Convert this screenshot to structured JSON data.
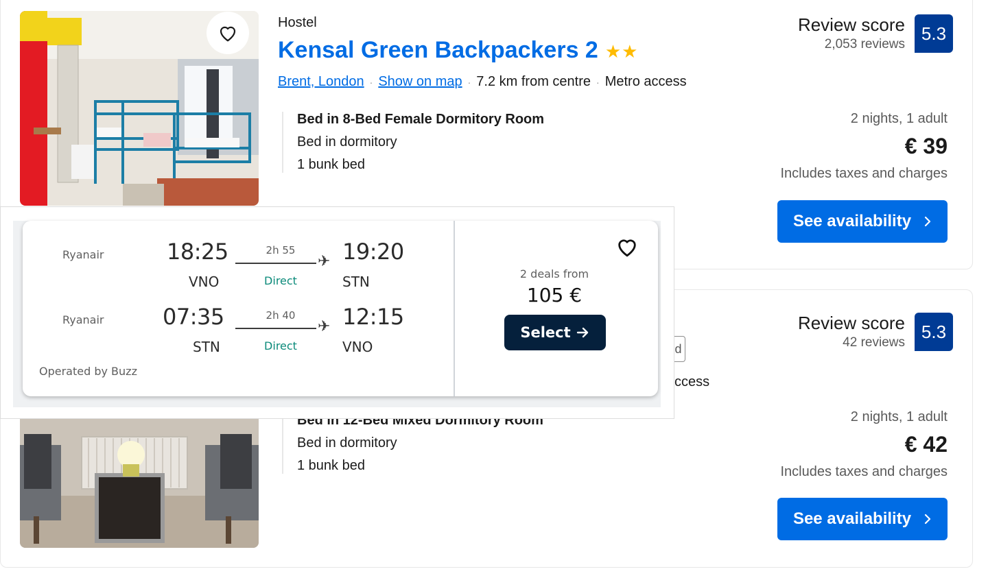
{
  "colors": {
    "link_blue": "#006ce4",
    "score_bg": "#003b95",
    "star": "#febb02",
    "select_bg": "#05203c",
    "direct_green": "#0b8a7a"
  },
  "listing1": {
    "type": "Hostel",
    "name": "Kensal Green Backpackers 2",
    "stars": "★★",
    "location": "Brent, London",
    "show_on_map": "Show on map",
    "distance": "7.2 km from centre",
    "metro": "Metro access",
    "room_title": "Bed in 8-Bed Female Dormitory Room",
    "room_type": "Bed in dormitory",
    "beds": "1 bunk bed",
    "review_label": "Review score",
    "review_count": "2,053 reviews",
    "score": "5.3",
    "nights": "2 nights, 1 adult",
    "price": "€ 39",
    "taxes": "Includes taxes and charges",
    "cta": "See availability",
    "wishlist_icon": "heart-icon"
  },
  "listing2": {
    "partial_tag": "d",
    "partial_access": "ccess",
    "room_title": "Bed in 12-Bed Mixed Dormitory Room",
    "room_type": "Bed in dormitory",
    "beds": "1 bunk bed",
    "review_label": "Review score",
    "review_count": "42 reviews",
    "score": "5.3",
    "nights": "2 nights, 1 adult",
    "price": "€ 42",
    "taxes": "Includes taxes and charges",
    "cta": "See availability"
  },
  "flight_ad": {
    "outbound": {
      "airline": "Ryanair",
      "depart_time": "18:25",
      "depart_airport": "VNO",
      "duration": "2h 55",
      "stops": "Direct",
      "arrive_time": "19:20",
      "arrive_airport": "STN"
    },
    "inbound": {
      "airline": "Ryanair",
      "depart_time": "07:35",
      "depart_airport": "STN",
      "duration": "2h 40",
      "stops": "Direct",
      "arrive_time": "12:15",
      "arrive_airport": "VNO"
    },
    "operated_by": "Operated by Buzz",
    "deals_from": "2 deals from",
    "price": "105 €",
    "select_label": "Select",
    "wishlist_icon": "heart-icon"
  }
}
